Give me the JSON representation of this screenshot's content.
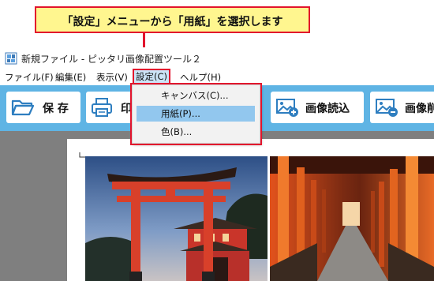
{
  "callout": {
    "text": "「設定」メニューから「用紙」を選択します"
  },
  "window": {
    "title": "新規ファイル - ピッタリ画像配置ツール２"
  },
  "menubar": {
    "items": [
      {
        "label": "ファイル(F)"
      },
      {
        "label": "編集(E)"
      },
      {
        "label": "表示(V)"
      },
      {
        "label": "設定(C)"
      },
      {
        "label": "ヘルプ(H)"
      }
    ]
  },
  "toolbar": {
    "save_label": "保 存",
    "print_label": "印",
    "load_image_label": "画像読込",
    "delete_image_label": "画像削"
  },
  "settings_menu": {
    "items": [
      {
        "label": "キャンバス(C)..."
      },
      {
        "label": "用紙(P)..."
      },
      {
        "label": "色(B)..."
      }
    ],
    "highlighted_index": 1
  },
  "colors": {
    "accent_red": "#e2142d",
    "toolbar_blue": "#5fb4e4",
    "callout_yellow": "#fff68f",
    "menu_highlight": "#92c7ee"
  }
}
